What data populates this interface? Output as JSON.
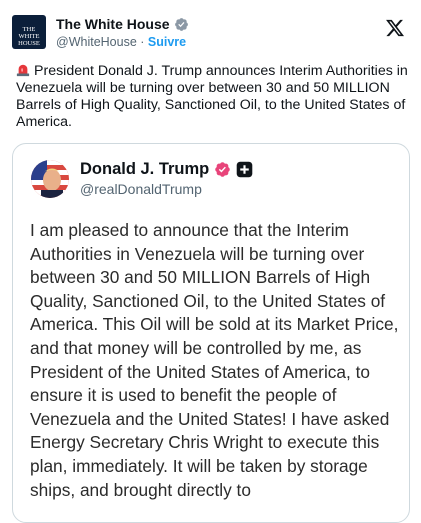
{
  "author": {
    "name": "The White House",
    "handle": "@WhiteHouse",
    "separator": " · ",
    "follow_label": "Suivre",
    "avatar_text": "THE WHITE HOUSE"
  },
  "tweet": {
    "text": "President Donald J. Trump announces Interim Authorities in Venezuela will be turning over between 30 and 50 MILLION Barrels of High Quality, Sanctioned Oil, to the United States of America."
  },
  "quoted": {
    "name": "Donald J. Trump",
    "handle": "@realDonaldTrump",
    "body": "I am pleased to announce that the Interim Authorities in Venezuela will be turning over between 30 and 50 MILLION Barrels of High Quality, Sanctioned Oil, to the United States of America. This Oil will be sold at its Market Price, and that money will be controlled by me, as President of the United States of America, to ensure it is used to benefit the people of Venezuela and the United States! I have asked Energy Secretary Chris Wright to execute this plan, immediately. It will be taken by storage ships, and brought directly to"
  },
  "colors": {
    "link_blue": "#1d9bf0",
    "verified_blue": "#1d9bf0",
    "gold_badge": "#e0ae1f",
    "pink_badge": "#e8447a"
  }
}
